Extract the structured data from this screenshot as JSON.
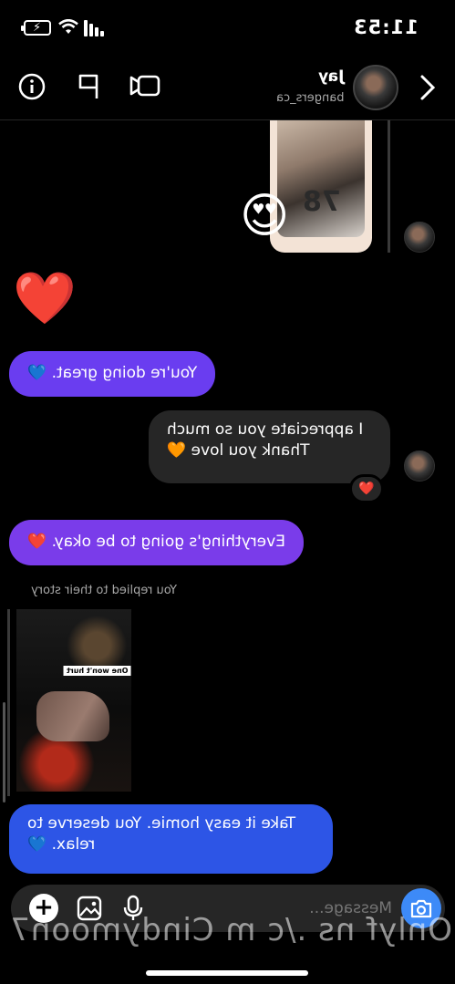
{
  "status_bar": {
    "time": "11:53"
  },
  "header": {
    "name": "Jay",
    "username": "bangers_ca",
    "icons": [
      "info-icon",
      "flag-icon",
      "video-icon",
      "chevron-right-icon"
    ]
  },
  "messages": {
    "m1": "You're doing great. 💙",
    "m2": "I appreciate you so much\nThank you love 🧡",
    "m2_reaction": "❤️",
    "m3": "Everything's going to be okay. ❤️",
    "story_reply_label": "You replied to their story",
    "story_caption": "One won't hurt",
    "m4": "Take it easy homie. You deserve to relax. 💙",
    "big_heart": "❤️",
    "story_reaction": "😍",
    "story_card_number": "78"
  },
  "composer": {
    "placeholder": "Message..."
  },
  "watermark": "Onlyf ns ./c m Cindymoon7"
}
